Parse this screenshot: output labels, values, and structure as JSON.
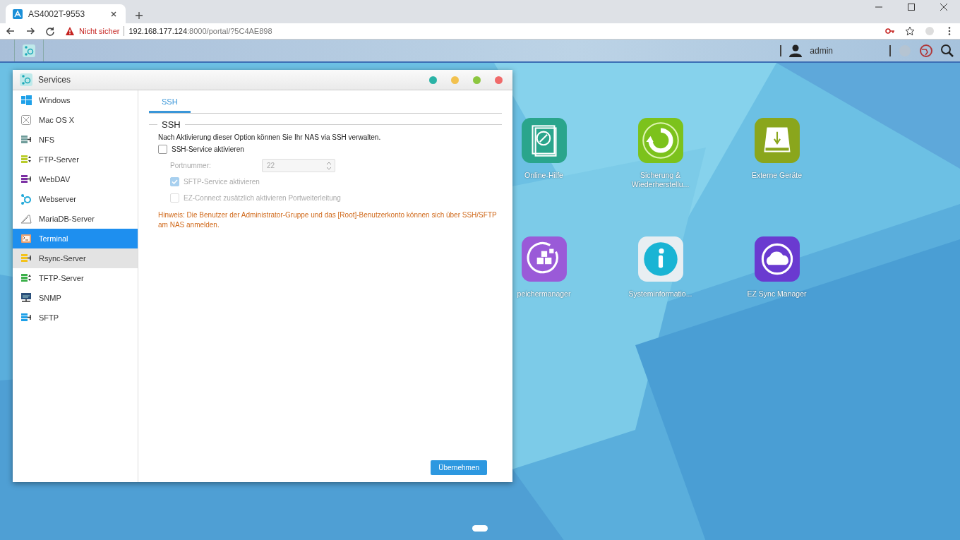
{
  "browser": {
    "tab": {
      "title": "AS4002T-9553",
      "selected": true
    },
    "security": "Nicht sicher",
    "url_host": "192.168.177.124",
    "url_rest": ":8000/portal/?5C4AE898"
  },
  "top_bar": {
    "user": "admin"
  },
  "window": {
    "title": "Services",
    "controls": [
      {
        "color": "#2ab3a6"
      },
      {
        "color": "#f2c14e"
      },
      {
        "color": "#8cc63f"
      },
      {
        "color": "#f06a6a"
      }
    ],
    "sidebar": [
      {
        "label": "Windows",
        "selected": false,
        "hovered": false
      },
      {
        "label": "Mac OS X",
        "selected": false,
        "hovered": false
      },
      {
        "label": "NFS",
        "selected": false,
        "hovered": false
      },
      {
        "label": "FTP-Server",
        "selected": false,
        "hovered": false
      },
      {
        "label": "WebDAV",
        "selected": false,
        "hovered": false
      },
      {
        "label": "Webserver",
        "selected": false,
        "hovered": false
      },
      {
        "label": "MariaDB-Server",
        "selected": false,
        "hovered": false
      },
      {
        "label": "Terminal",
        "selected": true,
        "hovered": false
      },
      {
        "label": "Rsync-Server",
        "selected": false,
        "hovered": true
      },
      {
        "label": "TFTP-Server",
        "selected": false,
        "hovered": false
      },
      {
        "label": "SNMP",
        "selected": false,
        "hovered": false
      },
      {
        "label": "SFTP",
        "selected": false,
        "hovered": false
      }
    ],
    "tabs": [
      {
        "label": "SSH",
        "selected": true
      }
    ],
    "section": {
      "title": "SSH",
      "description": "Nach Aktivierung dieser Option können Sie Ihr NAS via SSH verwalten.",
      "options": [
        {
          "kind": "checkbox",
          "label": "SSH-Service aktivieren",
          "checked": false,
          "disabled": false
        },
        {
          "kind": "number",
          "label": "Portnummer:",
          "value": "22",
          "disabled": true
        },
        {
          "kind": "checkbox",
          "label": "SFTP-Service aktivieren",
          "checked": true,
          "disabled": true
        },
        {
          "kind": "checkbox",
          "label": "EZ-Connect zusätzlich aktivieren Portweiterleitung",
          "checked": false,
          "disabled": true
        }
      ],
      "note": "Hinweis: Die Benutzer der Administrator-Gruppe und das [Root]-Benutzerkonto können sich über SSH/SFTP am NAS anmelden."
    },
    "apply_button": "Übernehmen"
  },
  "desktop_icons": [
    {
      "label": "Online-Hilfe",
      "color": "#2aa58c"
    },
    {
      "label": "Sicherung & Wiederherstellu...",
      "color": "#7cc21c"
    },
    {
      "label": "Externe Geräte",
      "color": "#8aa61c"
    },
    {
      "label": "peichermanager",
      "color": "#9a5ad8"
    },
    {
      "label": "Systeminformatio...",
      "color": "#e8eef2"
    },
    {
      "label": "EZ Sync Manager",
      "color": "#6a3ad0"
    }
  ]
}
